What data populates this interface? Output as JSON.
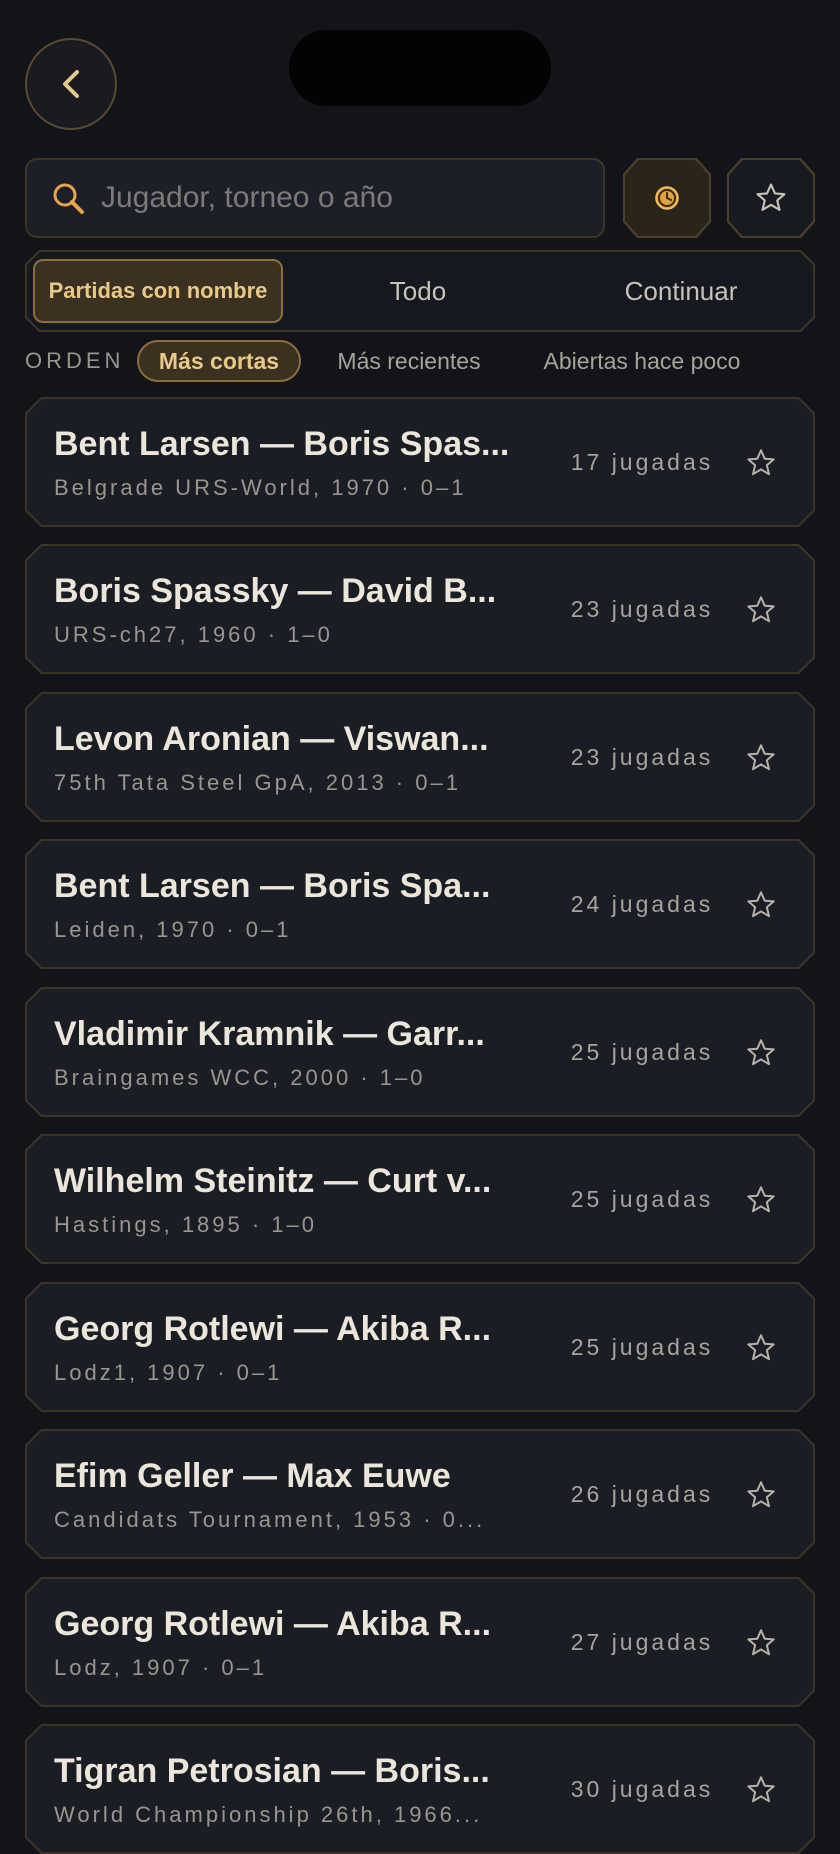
{
  "header": {
    "back_icon": "chevron-left-icon",
    "history_icon": "clock-icon",
    "favorites_icon": "star-icon"
  },
  "search": {
    "placeholder": "Jugador, torneo o año",
    "value": ""
  },
  "tabs": [
    {
      "label": "Partidas con nombre",
      "active": true
    },
    {
      "label": "Todo",
      "active": false
    },
    {
      "label": "Continuar",
      "active": false
    }
  ],
  "sort": {
    "label": "ORDEN",
    "options": [
      {
        "label": "Más cortas",
        "active": true
      },
      {
        "label": "Más recientes",
        "active": false
      },
      {
        "label": "Abiertas hace poco",
        "active": false
      }
    ]
  },
  "games": [
    {
      "title": "Bent Larsen — Boris Spas...",
      "subtitle": "Belgrade URS-World, 1970 · 0–1",
      "moves": "17 jugadas"
    },
    {
      "title": "Boris Spassky — David B...",
      "subtitle": "URS-ch27, 1960 · 1–0",
      "moves": "23 jugadas"
    },
    {
      "title": "Levon Aronian — Viswan...",
      "subtitle": "75th Tata Steel GpA, 2013 · 0–1",
      "moves": "23 jugadas"
    },
    {
      "title": "Bent Larsen — Boris Spa...",
      "subtitle": "Leiden, 1970 · 0–1",
      "moves": "24 jugadas"
    },
    {
      "title": "Vladimir Kramnik — Garr...",
      "subtitle": "Braingames WCC, 2000 · 1–0",
      "moves": "25 jugadas"
    },
    {
      "title": "Wilhelm Steinitz — Curt v...",
      "subtitle": "Hastings, 1895 · 1–0",
      "moves": "25 jugadas"
    },
    {
      "title": "Georg Rotlewi — Akiba R...",
      "subtitle": "Lodz1, 1907 · 0–1",
      "moves": "25 jugadas"
    },
    {
      "title": "Efim Geller — Max Euwe",
      "subtitle": "Candidats Tournament, 1953 · 0...",
      "moves": "26 jugadas"
    },
    {
      "title": "Georg Rotlewi — Akiba R...",
      "subtitle": "Lodz, 1907 · 0–1",
      "moves": "27 jugadas"
    },
    {
      "title": "Tigran Petrosian — Boris...",
      "subtitle": "World Championship 26th, 1966...",
      "moves": "30 jugadas"
    }
  ],
  "colors": {
    "background": "#121419",
    "accent_gold": "#e9c987",
    "border_gold": "#8a6f3c",
    "card": "#1a1d24"
  }
}
